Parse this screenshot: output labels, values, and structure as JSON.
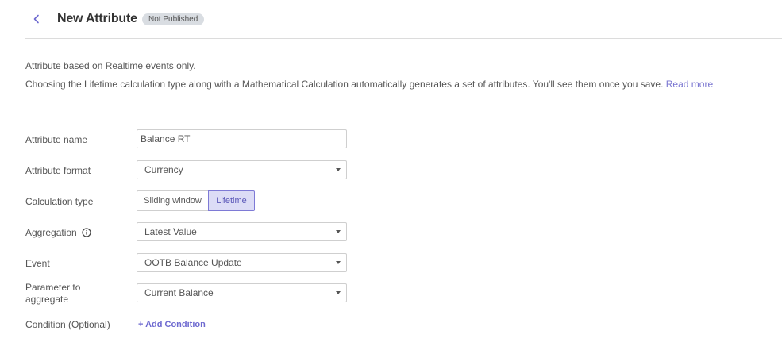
{
  "header": {
    "title": "New Attribute",
    "status_badge": "Not Published"
  },
  "info": {
    "line1": "Attribute based on Realtime events only.",
    "line2": "Choosing the Lifetime calculation type along with a Mathematical Calculation automatically generates a set of attributes. You'll see them once you save.",
    "read_more": "Read more"
  },
  "form": {
    "attribute_name": {
      "label": "Attribute name",
      "value": "Balance RT"
    },
    "attribute_format": {
      "label": "Attribute format",
      "value": "Currency"
    },
    "calculation_type": {
      "label": "Calculation type",
      "options": [
        "Sliding window",
        "Lifetime"
      ],
      "selected": "Lifetime"
    },
    "aggregation": {
      "label": "Aggregation",
      "value": "Latest Value",
      "icon": "info-icon"
    },
    "event": {
      "label": "Event",
      "value": "OOTB Balance Update"
    },
    "parameter": {
      "label": "Parameter to aggregate",
      "value": "Current Balance"
    },
    "condition": {
      "label": "Condition (Optional)",
      "add_label": "+ Add Condition"
    }
  },
  "colors": {
    "accent": "#7a76d1",
    "badge_bg": "#d9dde2",
    "active_bg": "#dcdcf6"
  }
}
